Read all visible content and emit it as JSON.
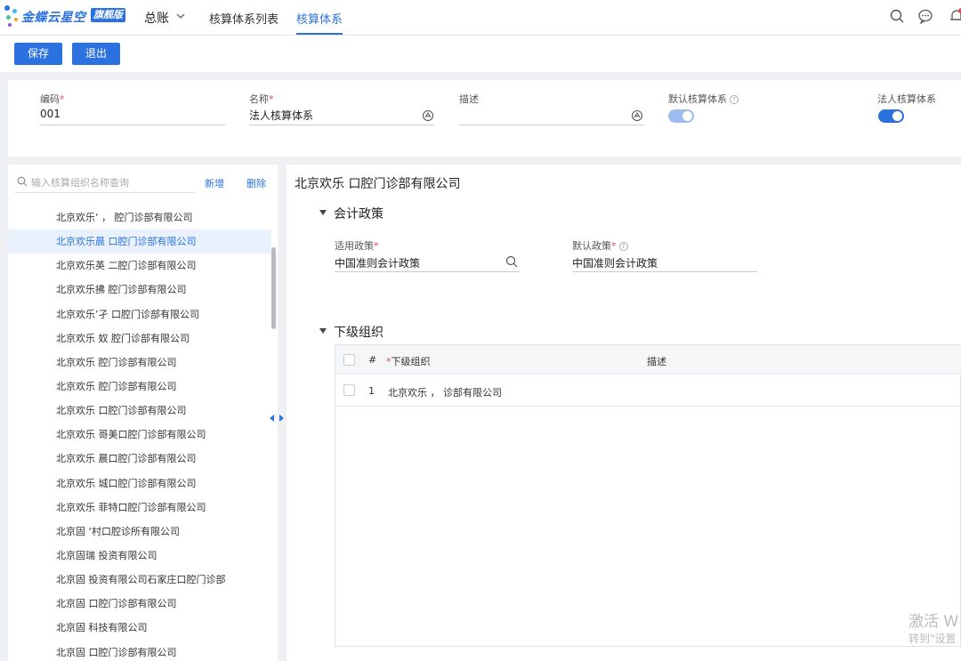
{
  "header": {
    "brand": "金蝶云星空",
    "edition": "旗舰版",
    "nav_home": "总账",
    "tabs": [
      {
        "label": "核算体系列表",
        "active": false
      },
      {
        "label": "核算体系",
        "active": true
      }
    ],
    "icons": [
      "search-icon",
      "message-icon",
      "notification-bell-icon"
    ],
    "accent_color": "#2b72e0"
  },
  "toolbar": {
    "save_label": "保存",
    "exit_label": "退出"
  },
  "form": {
    "code": {
      "label": "编码",
      "required": "*",
      "value": "001"
    },
    "name": {
      "label": "名称",
      "required": "*",
      "value": "法人核算体系"
    },
    "description": {
      "label": "描述",
      "value": ""
    },
    "default_system": {
      "label": "默认核算体系",
      "help": "?",
      "checked": true,
      "disabled": true
    },
    "legal_system": {
      "label": "法人核算体系",
      "checked": true
    }
  },
  "org_panel": {
    "search_placeholder": "输入核算组织名称查询",
    "add_label": "新增",
    "delete_label": "删除",
    "items": [
      "北京欢乐‘       ，  腔门诊部有限公司",
      "北京欢乐晨      口腔门诊部有限公司",
      "北京欢乐英    二腔门诊部有限公司",
      "北京欢乐拂    腔门诊部有限公司",
      "北京欢乐’孑     口腔门诊部有限公司",
      "北京欢乐  奴  腔门诊部有限公司",
      "北京欢乐      腔门诊部有限公司",
      "北京欢乐      腔门诊部有限公司",
      "北京欢乐   口腔门诊部有限公司",
      "北京欢乐  哥美口腔门诊部有限公司",
      "北京欢乐  晨口腔门诊部有限公司",
      "北京欢乐    城口腔门诊部有限公司",
      "北京欢乐    菲特口腔门诊部有限公司",
      "北京固    ‘村口腔诊所有限公司",
      "北京固瑞    投资有限公司",
      "北京固    投资有限公司石家庄口腔门诊部",
      "北京固     口腔门诊部有限公司",
      "北京固      科技有限公司",
      "北京固      口腔门诊部有限公司"
    ],
    "selected_index": 1
  },
  "detail": {
    "org_title": "北京欢乐    口腔门诊部有限公司",
    "accounting_policy_section": "会计政策",
    "applicable_policy": {
      "label": "适用政策",
      "required": "*",
      "value": "中国准则会计政策"
    },
    "default_policy": {
      "label": "默认政策",
      "required": "*",
      "help": "?",
      "value": "中国准则会计政策"
    },
    "sub_org_section": "下级组织",
    "grid": {
      "col_index": "#",
      "col_org_required": "*",
      "col_org": "下级组织",
      "col_desc": "描述",
      "rows": [
        {
          "index": "1",
          "org": "北京欢乐            ，  诊部有限公司",
          "desc": ""
        }
      ]
    }
  },
  "watermark": {
    "line1": "激活 W",
    "line2": "转到\"设置"
  }
}
